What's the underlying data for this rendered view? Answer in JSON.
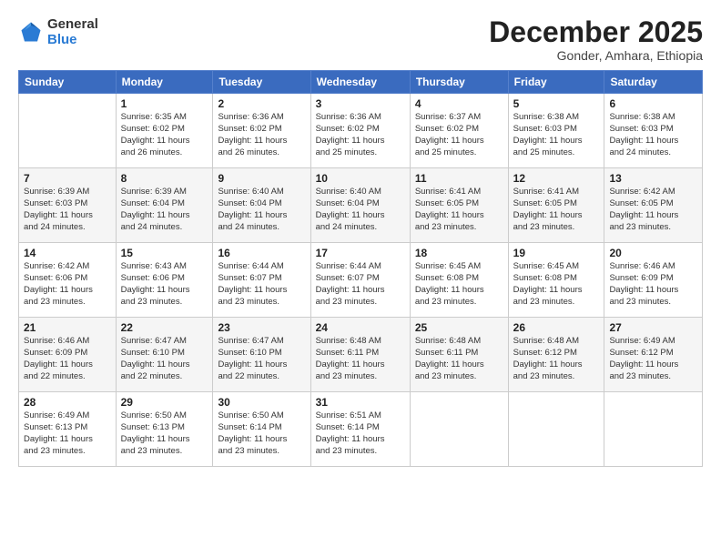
{
  "header": {
    "logo_general": "General",
    "logo_blue": "Blue",
    "month": "December 2025",
    "location": "Gonder, Amhara, Ethiopia"
  },
  "weekdays": [
    "Sunday",
    "Monday",
    "Tuesday",
    "Wednesday",
    "Thursday",
    "Friday",
    "Saturday"
  ],
  "weeks": [
    [
      {
        "day": "",
        "info": ""
      },
      {
        "day": "1",
        "info": "Sunrise: 6:35 AM\nSunset: 6:02 PM\nDaylight: 11 hours\nand 26 minutes."
      },
      {
        "day": "2",
        "info": "Sunrise: 6:36 AM\nSunset: 6:02 PM\nDaylight: 11 hours\nand 26 minutes."
      },
      {
        "day": "3",
        "info": "Sunrise: 6:36 AM\nSunset: 6:02 PM\nDaylight: 11 hours\nand 25 minutes."
      },
      {
        "day": "4",
        "info": "Sunrise: 6:37 AM\nSunset: 6:02 PM\nDaylight: 11 hours\nand 25 minutes."
      },
      {
        "day": "5",
        "info": "Sunrise: 6:38 AM\nSunset: 6:03 PM\nDaylight: 11 hours\nand 25 minutes."
      },
      {
        "day": "6",
        "info": "Sunrise: 6:38 AM\nSunset: 6:03 PM\nDaylight: 11 hours\nand 24 minutes."
      }
    ],
    [
      {
        "day": "7",
        "info": "Sunrise: 6:39 AM\nSunset: 6:03 PM\nDaylight: 11 hours\nand 24 minutes."
      },
      {
        "day": "8",
        "info": "Sunrise: 6:39 AM\nSunset: 6:04 PM\nDaylight: 11 hours\nand 24 minutes."
      },
      {
        "day": "9",
        "info": "Sunrise: 6:40 AM\nSunset: 6:04 PM\nDaylight: 11 hours\nand 24 minutes."
      },
      {
        "day": "10",
        "info": "Sunrise: 6:40 AM\nSunset: 6:04 PM\nDaylight: 11 hours\nand 24 minutes."
      },
      {
        "day": "11",
        "info": "Sunrise: 6:41 AM\nSunset: 6:05 PM\nDaylight: 11 hours\nand 23 minutes."
      },
      {
        "day": "12",
        "info": "Sunrise: 6:41 AM\nSunset: 6:05 PM\nDaylight: 11 hours\nand 23 minutes."
      },
      {
        "day": "13",
        "info": "Sunrise: 6:42 AM\nSunset: 6:05 PM\nDaylight: 11 hours\nand 23 minutes."
      }
    ],
    [
      {
        "day": "14",
        "info": "Sunrise: 6:42 AM\nSunset: 6:06 PM\nDaylight: 11 hours\nand 23 minutes."
      },
      {
        "day": "15",
        "info": "Sunrise: 6:43 AM\nSunset: 6:06 PM\nDaylight: 11 hours\nand 23 minutes."
      },
      {
        "day": "16",
        "info": "Sunrise: 6:44 AM\nSunset: 6:07 PM\nDaylight: 11 hours\nand 23 minutes."
      },
      {
        "day": "17",
        "info": "Sunrise: 6:44 AM\nSunset: 6:07 PM\nDaylight: 11 hours\nand 23 minutes."
      },
      {
        "day": "18",
        "info": "Sunrise: 6:45 AM\nSunset: 6:08 PM\nDaylight: 11 hours\nand 23 minutes."
      },
      {
        "day": "19",
        "info": "Sunrise: 6:45 AM\nSunset: 6:08 PM\nDaylight: 11 hours\nand 23 minutes."
      },
      {
        "day": "20",
        "info": "Sunrise: 6:46 AM\nSunset: 6:09 PM\nDaylight: 11 hours\nand 23 minutes."
      }
    ],
    [
      {
        "day": "21",
        "info": "Sunrise: 6:46 AM\nSunset: 6:09 PM\nDaylight: 11 hours\nand 22 minutes."
      },
      {
        "day": "22",
        "info": "Sunrise: 6:47 AM\nSunset: 6:10 PM\nDaylight: 11 hours\nand 22 minutes."
      },
      {
        "day": "23",
        "info": "Sunrise: 6:47 AM\nSunset: 6:10 PM\nDaylight: 11 hours\nand 22 minutes."
      },
      {
        "day": "24",
        "info": "Sunrise: 6:48 AM\nSunset: 6:11 PM\nDaylight: 11 hours\nand 23 minutes."
      },
      {
        "day": "25",
        "info": "Sunrise: 6:48 AM\nSunset: 6:11 PM\nDaylight: 11 hours\nand 23 minutes."
      },
      {
        "day": "26",
        "info": "Sunrise: 6:48 AM\nSunset: 6:12 PM\nDaylight: 11 hours\nand 23 minutes."
      },
      {
        "day": "27",
        "info": "Sunrise: 6:49 AM\nSunset: 6:12 PM\nDaylight: 11 hours\nand 23 minutes."
      }
    ],
    [
      {
        "day": "28",
        "info": "Sunrise: 6:49 AM\nSunset: 6:13 PM\nDaylight: 11 hours\nand 23 minutes."
      },
      {
        "day": "29",
        "info": "Sunrise: 6:50 AM\nSunset: 6:13 PM\nDaylight: 11 hours\nand 23 minutes."
      },
      {
        "day": "30",
        "info": "Sunrise: 6:50 AM\nSunset: 6:14 PM\nDaylight: 11 hours\nand 23 minutes."
      },
      {
        "day": "31",
        "info": "Sunrise: 6:51 AM\nSunset: 6:14 PM\nDaylight: 11 hours\nand 23 minutes."
      },
      {
        "day": "",
        "info": ""
      },
      {
        "day": "",
        "info": ""
      },
      {
        "day": "",
        "info": ""
      }
    ]
  ]
}
